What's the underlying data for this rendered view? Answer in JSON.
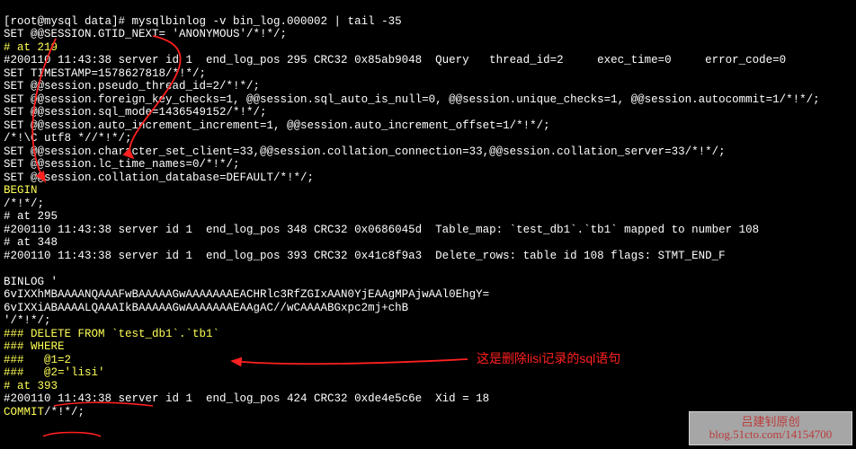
{
  "prompt": "[root@mysql data]# mysqlbinlog -v bin_log.000002 | tail -35",
  "lines": {
    "l1": "SET @@SESSION.GTID_NEXT= 'ANONYMOUS'/*!*/;",
    "l2": "# at 219",
    "l3": "#200110 11:43:38 server id 1  end_log_pos 295 CRC32 0x85ab9048  Query   thread_id=2     exec_time=0     error_code=0",
    "l4": "SET TIMESTAMP=1578627818/*!*/;",
    "l5": "SET @@session.pseudo_thread_id=2/*!*/;",
    "l6": "SET @@session.foreign_key_checks=1, @@session.sql_auto_is_null=0, @@session.unique_checks=1, @@session.autocommit=1/*!*/;",
    "l7": "SET @@session.sql_mode=1436549152/*!*/;",
    "l8": "SET @@session.auto_increment_increment=1, @@session.auto_increment_offset=1/*!*/;",
    "l9": "/*!\\C utf8 *//*!*/;",
    "l10": "SET @@session.character_set_client=33,@@session.collation_connection=33,@@session.collation_server=33/*!*/;",
    "l11": "SET @@session.lc_time_names=0/*!*/;",
    "l12": "SET @@session.collation_database=DEFAULT/*!*/;",
    "l13": "BEGIN",
    "l14": "/*!*/;",
    "l15": "# at 295",
    "l16": "#200110 11:43:38 server id 1  end_log_pos 348 CRC32 0x0686045d  Table_map: `test_db1`.`tb1` mapped to number 108",
    "l17": "# at 348",
    "l18": "#200110 11:43:38 server id 1  end_log_pos 393 CRC32 0x41c8f9a3  Delete_rows: table id 108 flags: STMT_END_F",
    "l19": "",
    "l20": "BINLOG '",
    "l21": "6vIXXhMBAAAANQAAAFwBAAAAAGwAAAAAAAEACHRlc3RfZGIxAAN0YjEAAgMPAjwAAl0EhgY=",
    "l22": "6vIXXiABAAAALQAAAIkBAAAAAGwAAAAAAAEAAgAC//wCAAAABGxpc2mj+chB",
    "l23": "'/*!*/;",
    "l24": "### DELETE FROM `test_db1`.`tb1`",
    "l25": "### WHERE",
    "l26": "###   @1=2",
    "l27": "###   @2='lisi'",
    "l28": "# at 393",
    "l29": "#200110 11:43:38 server id 1  end_log_pos 424 CRC32 0xde4e5c6e  Xid = 18",
    "l30a": "COMMIT",
    "l30b": "/*!*/;"
  },
  "annotation1": "这是删除lisi记录的sql语句",
  "watermark": {
    "line1": "吕建钊原创",
    "line2": "blog.51cto.com/14154700"
  }
}
